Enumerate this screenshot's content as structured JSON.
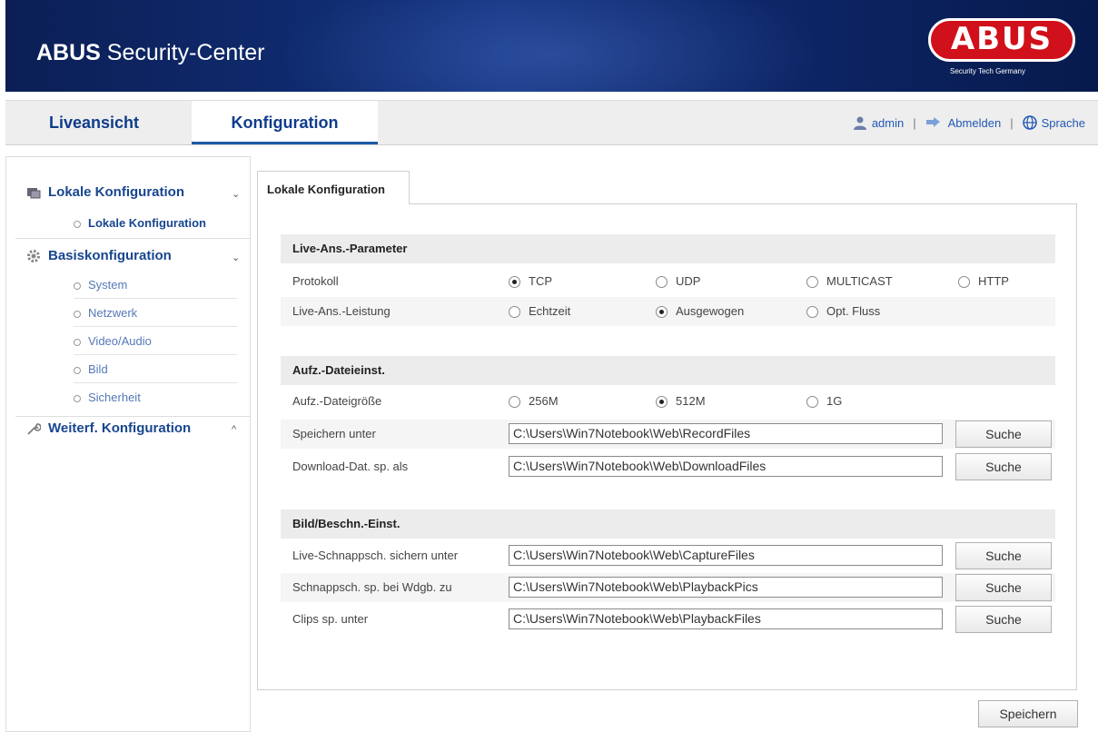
{
  "header": {
    "title_bold": "ABUS",
    "title_rest": " Security-Center",
    "logo_text": "ABUS",
    "logo_tagline": "Security Tech Germany"
  },
  "nav": {
    "tabs": [
      {
        "label": "Liveansicht"
      },
      {
        "label": "Konfiguration",
        "active": true
      }
    ],
    "user": "admin",
    "logout": "Abmelden",
    "language": "Sprache",
    "separator": "|"
  },
  "sidebar": {
    "groups": [
      {
        "label": "Lokale Konfiguration",
        "chevron": "⌄",
        "icon": "local-config-icon",
        "items": [
          {
            "label": "Lokale Konfiguration",
            "active": true
          }
        ]
      },
      {
        "label": "Basiskonfiguration",
        "chevron": "⌄",
        "icon": "gear-icon",
        "items": [
          {
            "label": "System"
          },
          {
            "label": "Netzwerk"
          },
          {
            "label": "Video/Audio"
          },
          {
            "label": "Bild"
          },
          {
            "label": "Sicherheit"
          }
        ]
      },
      {
        "label": "Weiterf. Konfiguration",
        "chevron": "^",
        "icon": "wrench-icon",
        "items": []
      }
    ]
  },
  "content": {
    "tab_label": "Lokale Konfiguration",
    "sections": [
      {
        "title": "Live-Ans.-Parameter",
        "rows": [
          {
            "label": "Protokoll",
            "options": [
              "TCP",
              "UDP",
              "MULTICAST",
              "HTTP"
            ],
            "selected": "TCP"
          },
          {
            "label": "Live-Ans.-Leistung",
            "options": [
              "Echtzeit",
              "Ausgewogen",
              "Opt. Fluss"
            ],
            "selected": "Ausgewogen"
          }
        ]
      },
      {
        "title": "Aufz.-Dateieinst.",
        "rows": [
          {
            "label": "Aufz.-Dateigröße",
            "options": [
              "256M",
              "512M",
              "1G"
            ],
            "selected": "512M"
          },
          {
            "label": "Speichern unter",
            "value": "C:\\Users\\Win7Notebook\\Web\\RecordFiles",
            "button": "Suche"
          },
          {
            "label": "Download-Dat. sp. als",
            "value": "C:\\Users\\Win7Notebook\\Web\\DownloadFiles",
            "button": "Suche"
          }
        ]
      },
      {
        "title": "Bild/Beschn.-Einst.",
        "rows": [
          {
            "label": "Live-Schnappsch. sichern unter",
            "value": "C:\\Users\\Win7Notebook\\Web\\CaptureFiles",
            "button": "Suche"
          },
          {
            "label": "Schnappsch. sp. bei Wdgb. zu",
            "value": "C:\\Users\\Win7Notebook\\Web\\PlaybackPics",
            "button": "Suche"
          },
          {
            "label": "Clips sp. unter",
            "value": "C:\\Users\\Win7Notebook\\Web\\PlaybackFiles",
            "button": "Suche"
          }
        ]
      }
    ],
    "save_label": "Speichern"
  },
  "colors": {
    "banner": "#12327e",
    "link": "#17468f",
    "logo_red": "#d0101a"
  }
}
